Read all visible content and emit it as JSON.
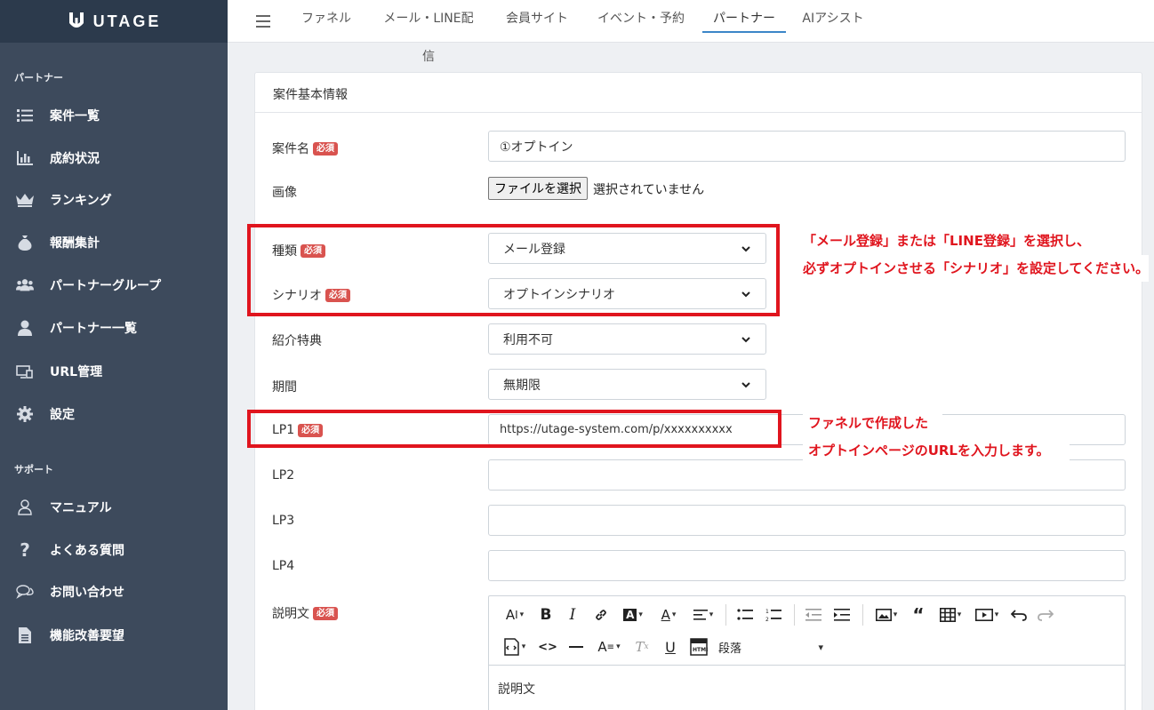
{
  "app": {
    "logo_text": "UTAGE"
  },
  "sidebar": {
    "sections": [
      {
        "title": "パートナー"
      },
      {
        "title": "サポート"
      }
    ],
    "items": [
      {
        "label": "案件一覧",
        "icon": "list-icon"
      },
      {
        "label": "成約状況",
        "icon": "bar-chart-icon"
      },
      {
        "label": "ランキング",
        "icon": "crown-icon"
      },
      {
        "label": "報酬集計",
        "icon": "money-bag-icon"
      },
      {
        "label": "パートナーグループ",
        "icon": "users-icon"
      },
      {
        "label": "パートナー一覧",
        "icon": "user-icon"
      },
      {
        "label": "URL管理",
        "icon": "link-monitor-icon"
      },
      {
        "label": "設定",
        "icon": "gear-icon"
      },
      {
        "label": "マニュアル",
        "icon": "person-outline-icon"
      },
      {
        "label": "よくある質問",
        "icon": "question-icon"
      },
      {
        "label": "お問い合わせ",
        "icon": "chat-icon"
      },
      {
        "label": "機能改善要望",
        "icon": "document-icon"
      }
    ]
  },
  "topnav": {
    "tabs": [
      {
        "label": "ファネル"
      },
      {
        "label": "メール・LINE配信"
      },
      {
        "label": "会員サイト"
      },
      {
        "label": "イベント・予約"
      },
      {
        "label": "パートナー",
        "active": true
      },
      {
        "label": "AIアシスト"
      }
    ]
  },
  "card": {
    "title": "案件基本情報"
  },
  "form": {
    "required_badge": "必須",
    "name": {
      "label": "案件名",
      "value": "①オプトイン"
    },
    "image": {
      "label": "画像",
      "button": "ファイルを選択",
      "status": "選択されていません"
    },
    "type": {
      "label": "種類",
      "value": "メール登録"
    },
    "scenario": {
      "label": "シナリオ",
      "value": "オプトインシナリオ"
    },
    "bonus": {
      "label": "紹介特典",
      "value": "利用不可"
    },
    "period": {
      "label": "期間",
      "value": "無期限"
    },
    "lp1": {
      "label": "LP1",
      "value": "https://utage-system.com/p/xxxxxxxxxx"
    },
    "lp2": {
      "label": "LP2",
      "value": ""
    },
    "lp3": {
      "label": "LP3",
      "value": ""
    },
    "lp4": {
      "label": "LP4",
      "value": ""
    },
    "description": {
      "label": "説明文",
      "content": "説明文",
      "paragraph_select": "段落"
    }
  },
  "annotations": {
    "type_note_line1": "「メール登録」または「LINE登録」を選択し、",
    "type_note_line2": "必ずオプトインさせる「シナリオ」を設定してください。",
    "lp_note_line1": "ファネルで作成した",
    "lp_note_line2": "オプトインページのURLを入力します。"
  },
  "colors": {
    "sidebar": "#3d4a5c",
    "sidebar_top": "#2c3a4c",
    "accent": "#3b86c8",
    "required": "#d9534f",
    "annotation": "#e0151e"
  }
}
